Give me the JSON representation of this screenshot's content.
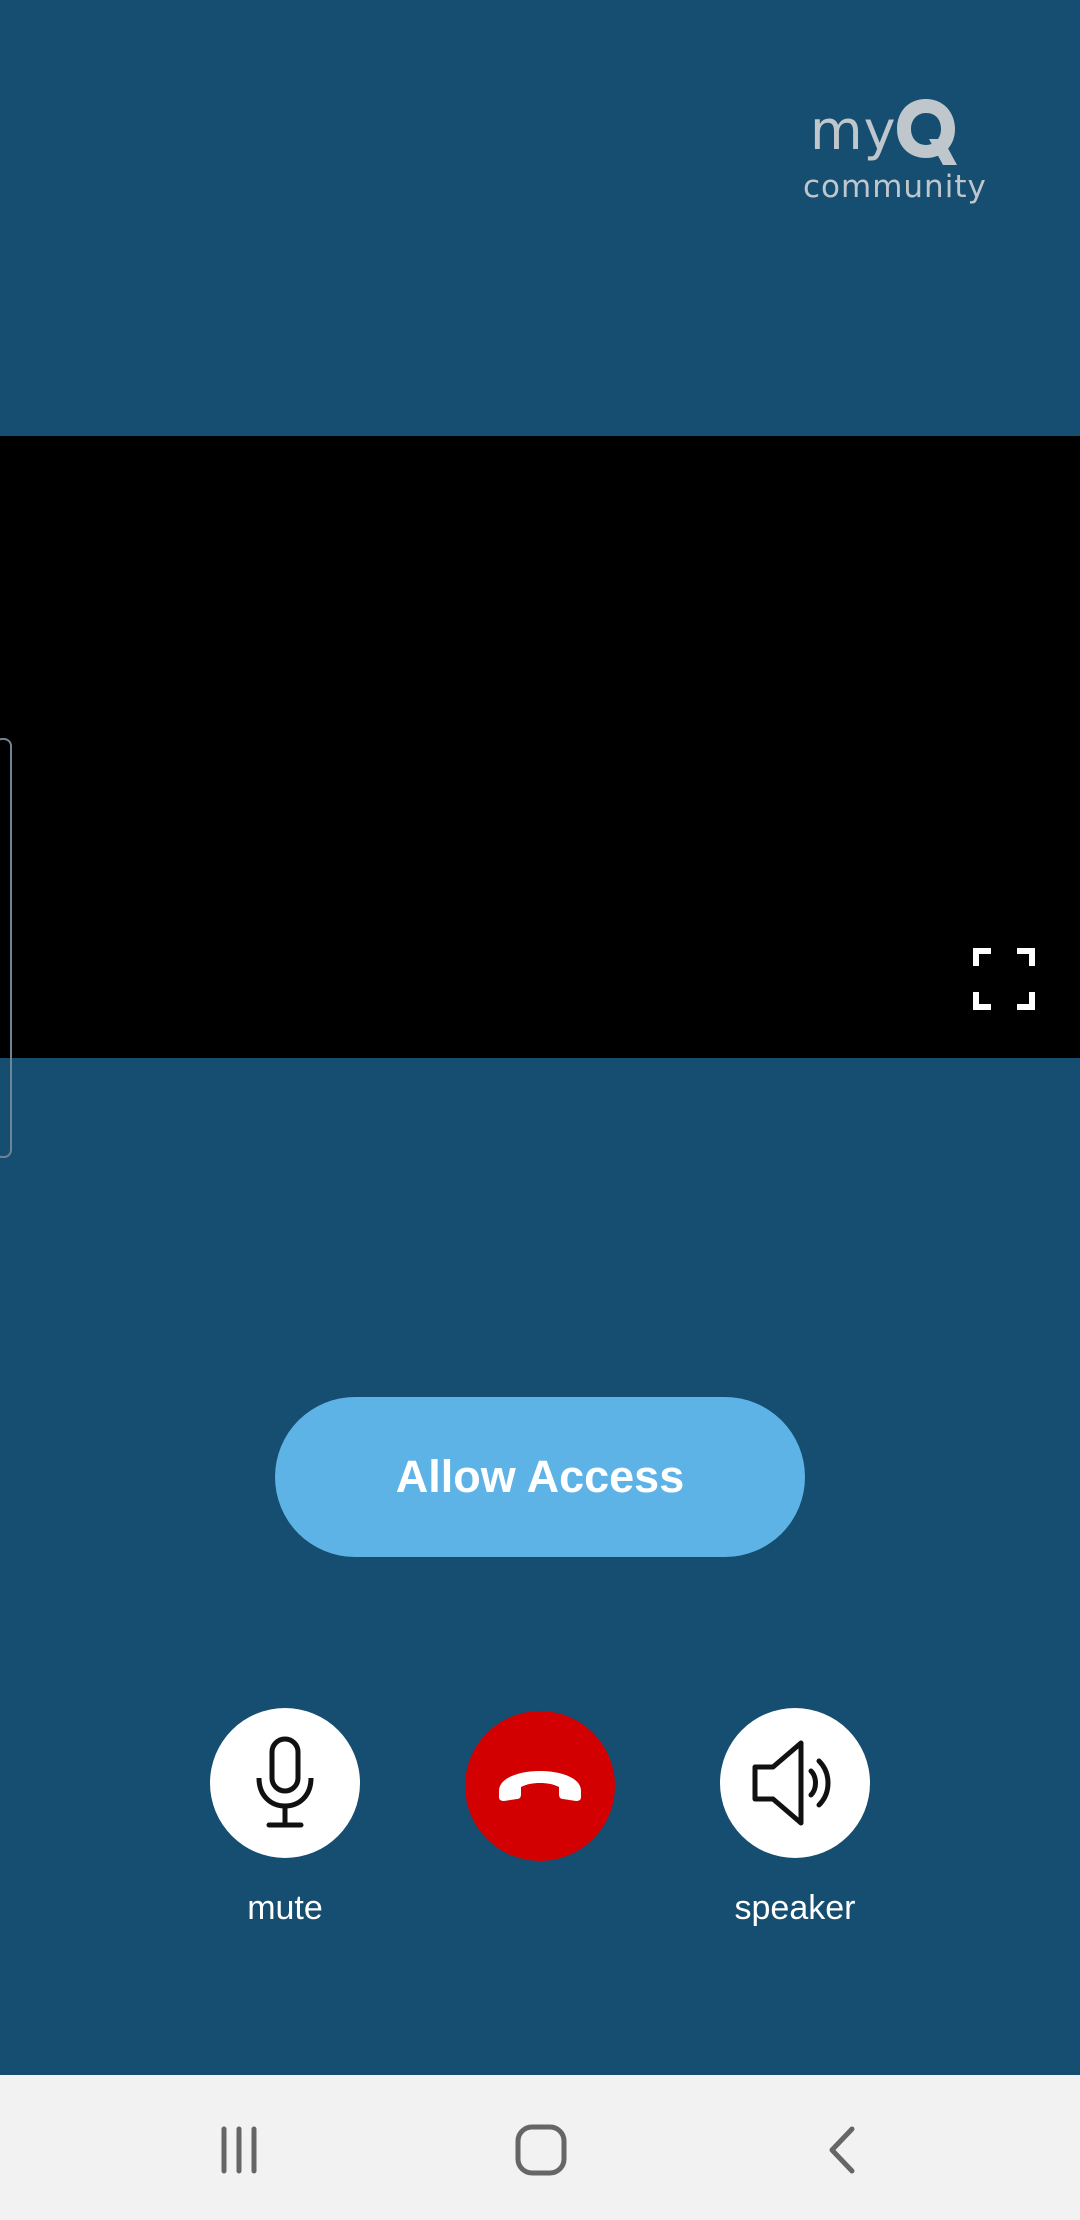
{
  "app": {
    "brand_top": "my",
    "brand_letter": "Q",
    "brand_bottom": "community"
  },
  "video": {
    "fullscreen_icon": "fullscreen-icon"
  },
  "actions": {
    "allow_access_label": "Allow Access"
  },
  "controls": {
    "mute_label": "mute",
    "speaker_label": "speaker",
    "mute_icon": "microphone-icon",
    "hangup_icon": "phone-hangup-icon",
    "speaker_icon": "speaker-icon"
  },
  "nav": {
    "recents_icon": "recents-icon",
    "home_icon": "home-icon",
    "back_icon": "back-icon"
  },
  "colors": {
    "background": "#154e70",
    "accent": "#5db3e6",
    "hangup": "#d20000",
    "navbar": "#f2f2f2"
  }
}
